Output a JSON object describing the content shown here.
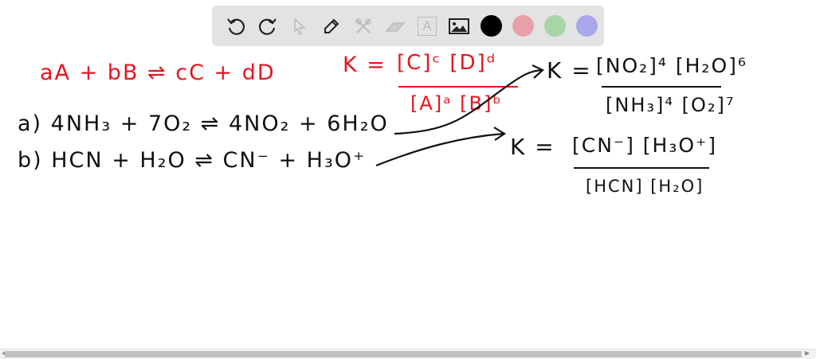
{
  "toolbar": {
    "tools": [
      "undo-icon",
      "redo-icon",
      "select-icon",
      "pen-icon",
      "tools-icon",
      "eraser-icon",
      "text-icon",
      "image-icon"
    ],
    "text_tool_label": "A",
    "colors": [
      "#000000",
      "#e8a0a6",
      "#a8d4a8",
      "#a9a6ea"
    ]
  },
  "board": {
    "general_eq": "aA + bB ⇌ cC + dD",
    "general_k_prefix": "K =",
    "general_k_num": "[C]ᶜ [D]ᵈ",
    "general_k_den": "[A]ᵃ [B]ᵇ",
    "eq_a": "a)  4NH₃ + 7O₂ ⇌ 4NO₂ + 6H₂O",
    "eq_b": "b)  HCN + H₂O ⇌ CN⁻ +  H₃O⁺",
    "ka_prefix": "K =",
    "ka_num": "[NO₂]⁴ [H₂O]⁶",
    "ka_den": "[NH₃]⁴ [O₂]⁷",
    "kb_prefix": "K =",
    "kb_num": "[CN⁻] [H₃O⁺]",
    "kb_den": "[HCN] [H₂O]"
  }
}
